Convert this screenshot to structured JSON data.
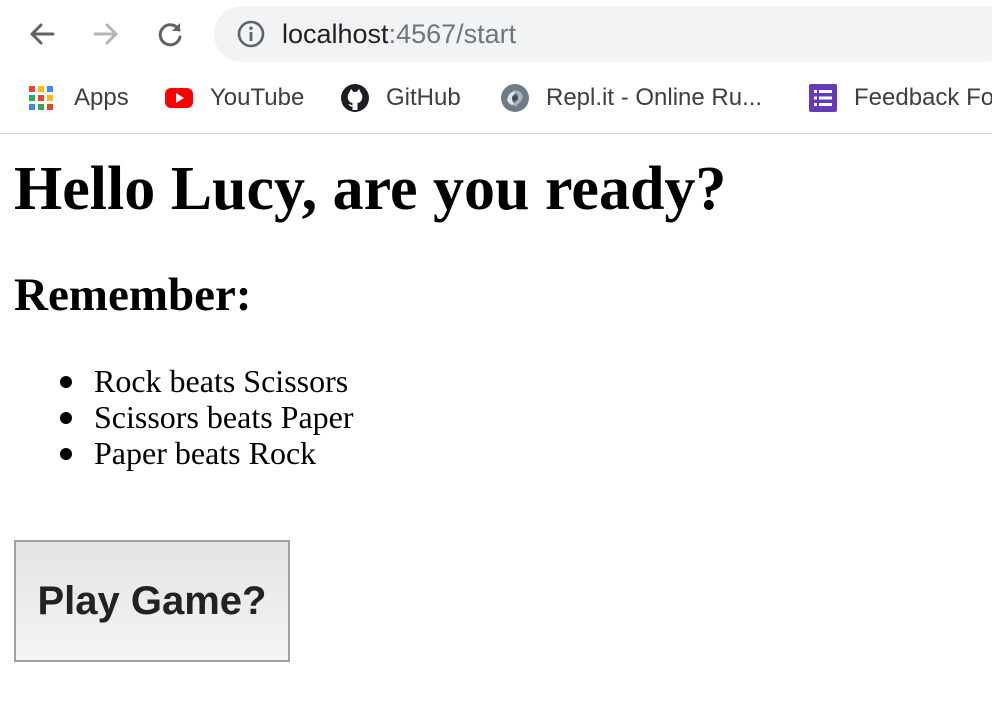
{
  "toolbar": {
    "url_host": "localhost",
    "url_path": ":4567/start"
  },
  "bookmarks": [
    {
      "label": "Apps",
      "icon": "apps-grid-icon"
    },
    {
      "label": "YouTube",
      "icon": "youtube-icon"
    },
    {
      "label": "GitHub",
      "icon": "github-icon"
    },
    {
      "label": "Repl.it - Online Ru...",
      "icon": "replit-icon"
    },
    {
      "label": "Feedback Fo",
      "icon": "forms-icon"
    }
  ],
  "page": {
    "heading": "Hello Lucy, are you ready?",
    "subheading": "Remember:",
    "rules": [
      "Rock beats Scissors",
      "Scissors beats Paper",
      "Paper beats Rock"
    ],
    "play_button": "Play Game?"
  },
  "colors": {
    "omnibox_bg": "#f1f3f4",
    "youtube_red": "#ff0000",
    "forms_purple": "#673ab7"
  }
}
